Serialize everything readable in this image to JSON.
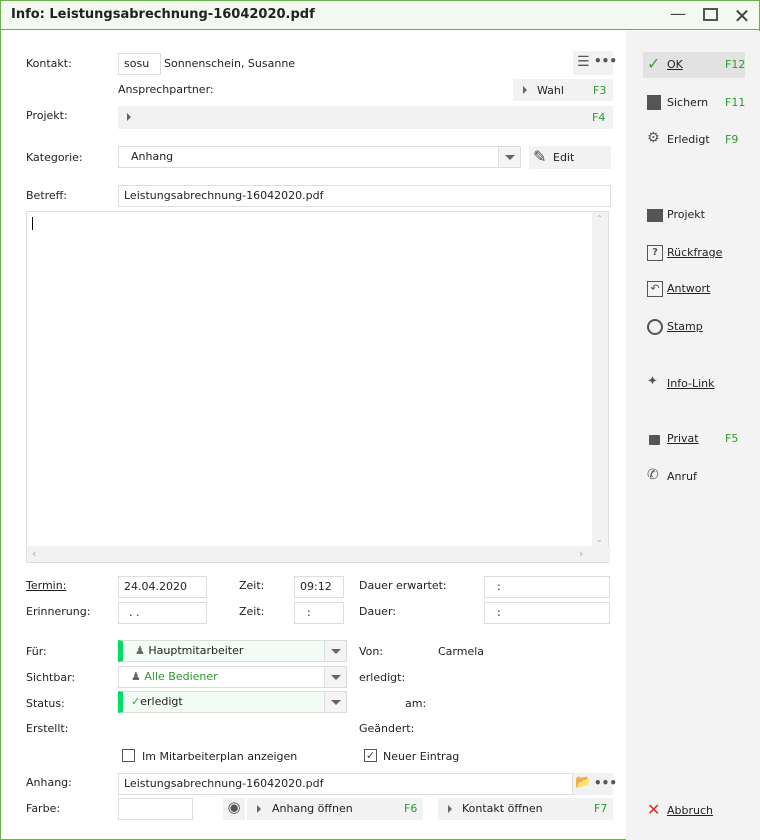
{
  "window": {
    "title": "Info: Leistungsabrechnung-16042020.pdf"
  },
  "form": {
    "kontakt_label": "Kontakt:",
    "kontakt_code": "sosu",
    "kontakt_name": "Sonnenschein, Susanne",
    "ansprechpartner_label": "Ansprechpartner:",
    "wahl_label": "Wahl",
    "wahl_key": "F3",
    "projekt_label": "Projekt:",
    "projekt_key": "F4",
    "kategorie_label": "Kategorie:",
    "kategorie_value": "Anhang",
    "edit_label": "Edit",
    "betreff_label": "Betreff:",
    "betreff_value": "Leistungsabrechnung-16042020.pdf",
    "body_text": "",
    "termin_label": "Termin:",
    "termin_value": "24.04.2020",
    "zeit1_label": "Zeit:",
    "zeit1_value": "09:12",
    "dauer_erwartet_label": "Dauer erwartet:",
    "dauer_erwartet_value": ":",
    "erinnerung_label": "Erinnerung:",
    "erinnerung_value": ". .",
    "zeit2_label": "Zeit:",
    "zeit2_value": ":",
    "dauer_label": "Dauer:",
    "dauer_value": ":",
    "fuer_label": "Für:",
    "fuer_value": "Hauptmitarbeiter",
    "von_label": "Von:",
    "von_value": "Carmela",
    "sichtbar_label": "Sichtbar:",
    "sichtbar_value": "Alle Bediener",
    "erledigt_label": "erledigt:",
    "status_label": "Status:",
    "status_value": "erledigt",
    "am_label": "am:",
    "erstellt_label": "Erstellt:",
    "geaendert_label": "Geändert:",
    "mitarbeiterplan_label": "Im Mitarbeiterplan anzeigen",
    "mitarbeiterplan_checked": false,
    "neuer_eintrag_label": "Neuer Eintrag",
    "neuer_eintrag_checked": true,
    "anhang_label": "Anhang:",
    "anhang_value": "Leistungsabrechnung-16042020.pdf",
    "farbe_label": "Farbe:",
    "anhang_oeffnen_label": "Anhang öffnen",
    "anhang_oeffnen_key": "F6",
    "kontakt_oeffnen_label": "Kontakt öffnen",
    "kontakt_oeffnen_key": "F7"
  },
  "sidebar": {
    "ok": {
      "label": "OK",
      "key": "F12"
    },
    "sichern": {
      "label": "Sichern",
      "key": "F11"
    },
    "erledigt": {
      "label": "Erledigt",
      "key": "F9"
    },
    "projekt": {
      "label": "Projekt"
    },
    "rueckfrage": {
      "label": "Rückfrage"
    },
    "antwort": {
      "label": "Antwort"
    },
    "stamp": {
      "label": "Stamp"
    },
    "infolink": {
      "label": "Info-Link"
    },
    "privat": {
      "label": "Privat",
      "key": "F5"
    },
    "anruf": {
      "label": "Anruf"
    },
    "abbruch": {
      "label": "Abbruch"
    }
  },
  "colors": {
    "accent": "#6ab04c",
    "status_green": "#00e060",
    "key_green": "#2a9a2a"
  }
}
